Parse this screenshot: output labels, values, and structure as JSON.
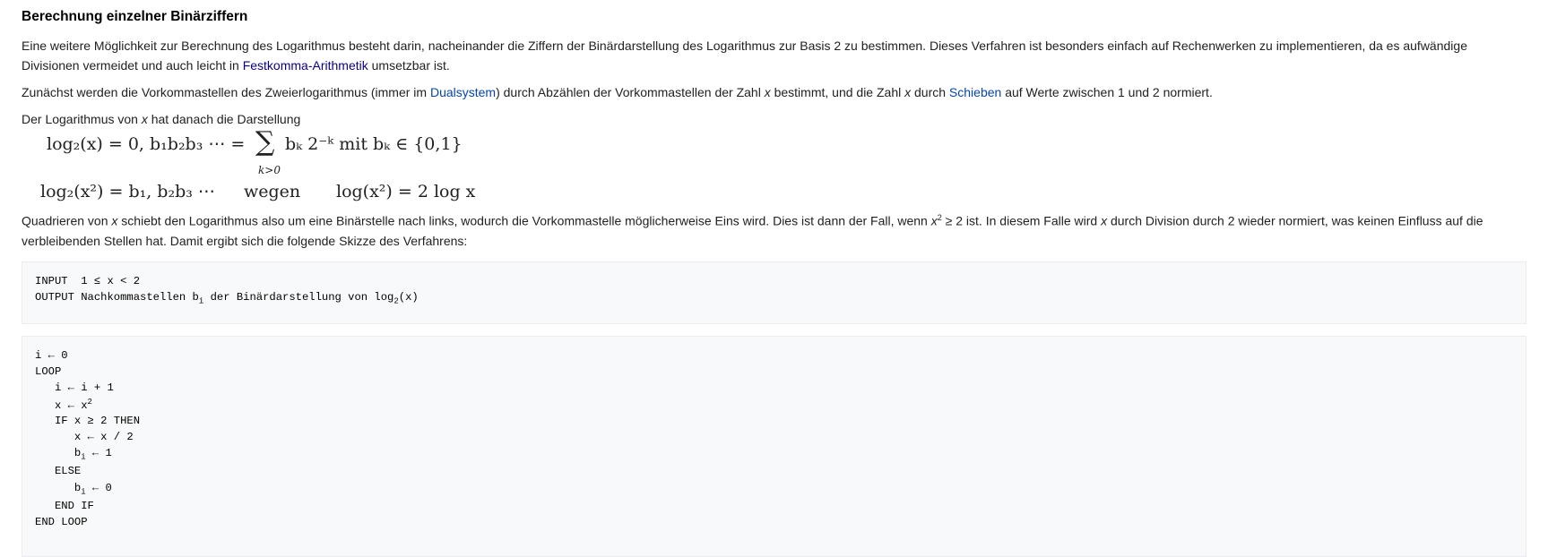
{
  "section": {
    "title": "Berechnung einzelner Binärziffern"
  },
  "para1": {
    "text_a": "Eine weitere Möglichkeit zur Berechnung des Logarithmus besteht darin, nacheinander die Ziffern der Binärdarstellung des Logarithmus zur Basis 2 zu bestimmen. Dieses Verfahren ist besonders einfach auf Rechenwerken zu implementieren, da es aufwändige Divisionen vermeidet und auch leicht in ",
    "link": "Festkomma-Arithmetik",
    "text_b": " umsetzbar ist."
  },
  "para2": {
    "text_a": "Zunächst werden die Vorkommastellen des Zweierlogarithmus (immer im ",
    "link1": "Dualsystem",
    "text_b": ") durch Abzählen der Vorkommastellen der Zahl ",
    "var1": "x",
    "text_c": " bestimmt, und die Zahl ",
    "var2": "x",
    "text_d": " durch ",
    "link2": "Schieben",
    "text_e": " auf Werte zwischen 1 und 2 normiert."
  },
  "para3": {
    "text_a": "Der Logarithmus von ",
    "var": "x",
    "text_b": " hat danach die Darstellung"
  },
  "formula1": {
    "lhs": "log₂(x) = 0, b₁b₂b₃ ⋯ =",
    "sigma": "∑",
    "sigma_sub": "k>0",
    "rhs": "bₖ 2⁻ᵏ  mit  bₖ ∈ {0,1}"
  },
  "formula2": {
    "lhs": "log₂(x²) = b₁, b₂b₃ ⋯",
    "mid": "wegen",
    "rhs": "log(x²) = 2 log x"
  },
  "para4": {
    "text_a": "Quadrieren von ",
    "var1": "x",
    "text_b": " schiebt den Logarithmus also um eine Binärstelle nach links, wodurch die Vorkommastelle möglicherweise Eins wird. Dies ist dann der Fall, wenn ",
    "var2": "x",
    "sup": "2",
    "text_c": " ≥ 2 ist. In diesem Falle wird ",
    "var3": "x",
    "text_d": " durch Division durch 2 wieder normiert, was keinen Einfluss auf die verbleibenden Stellen hat. Damit ergibt sich die folgende Skizze des Verfahrens:"
  },
  "code1": {
    "line1": "INPUT  1 ≤ x < 2",
    "line2_a": "OUTPUT Nachkommastellen b",
    "line2_sub": "i",
    "line2_b": " der Binärdarstellung von log",
    "line2_sub2": "2",
    "line2_c": "(x)"
  },
  "code2": {
    "l1": "i ← 0",
    "l2": "LOOP",
    "l3": "   i ← i + 1",
    "l4_a": "   x ← x",
    "l4_sup": "2",
    "l5": "   IF x ≥ 2 THEN",
    "l6": "      x ← x / 2",
    "l7_a": "      b",
    "l7_sub": "i",
    "l7_b": " ← 1",
    "l8": "   ELSE",
    "l9_a": "      b",
    "l9_sub": "i",
    "l9_b": " ← 0",
    "l10": "   END IF",
    "l11": "END LOOP"
  }
}
